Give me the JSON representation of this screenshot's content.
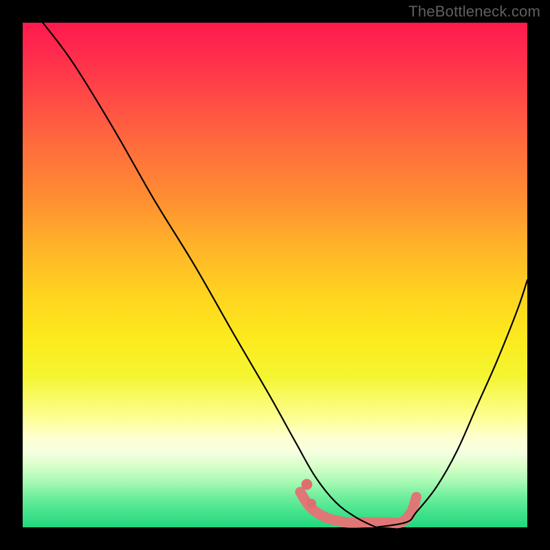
{
  "watermark": "TheBottleneck.com",
  "chart_data": {
    "type": "line",
    "title": "",
    "xlabel": "",
    "ylabel": "",
    "xlim": [
      0,
      100
    ],
    "ylim": [
      0,
      100
    ],
    "series": [
      {
        "name": "curve-left",
        "x": [
          4,
          10,
          18,
          26,
          34,
          42,
          49,
          54,
          58,
          62,
          66,
          70
        ],
        "values": [
          100,
          92,
          79,
          65,
          52,
          38,
          26,
          17,
          10,
          5,
          2,
          0
        ]
      },
      {
        "name": "curve-right",
        "x": [
          70,
          76,
          78,
          82,
          86,
          90,
          94,
          98,
          100
        ],
        "values": [
          0,
          1,
          3,
          8,
          15,
          24,
          33,
          43,
          49
        ]
      },
      {
        "name": "highlight-band",
        "x": [
          55,
          57,
          60,
          64,
          68,
          72,
          75,
          77,
          78
        ],
        "values": [
          7,
          4,
          2,
          1,
          1,
          1,
          1,
          3,
          6
        ]
      }
    ],
    "gradient_stops": [
      {
        "pos": 0,
        "color": "#ff1a4d"
      },
      {
        "pos": 34,
        "color": "#ff8b33"
      },
      {
        "pos": 63,
        "color": "#fceb1e"
      },
      {
        "pos": 82,
        "color": "#feffce"
      },
      {
        "pos": 100,
        "color": "#22d77f"
      }
    ],
    "colors": {
      "curve": "#000000",
      "highlight": "#e07777",
      "highlight_dot": "#df6f6f"
    },
    "stroke_width": {
      "curve": 2.2,
      "highlight": 15
    }
  }
}
